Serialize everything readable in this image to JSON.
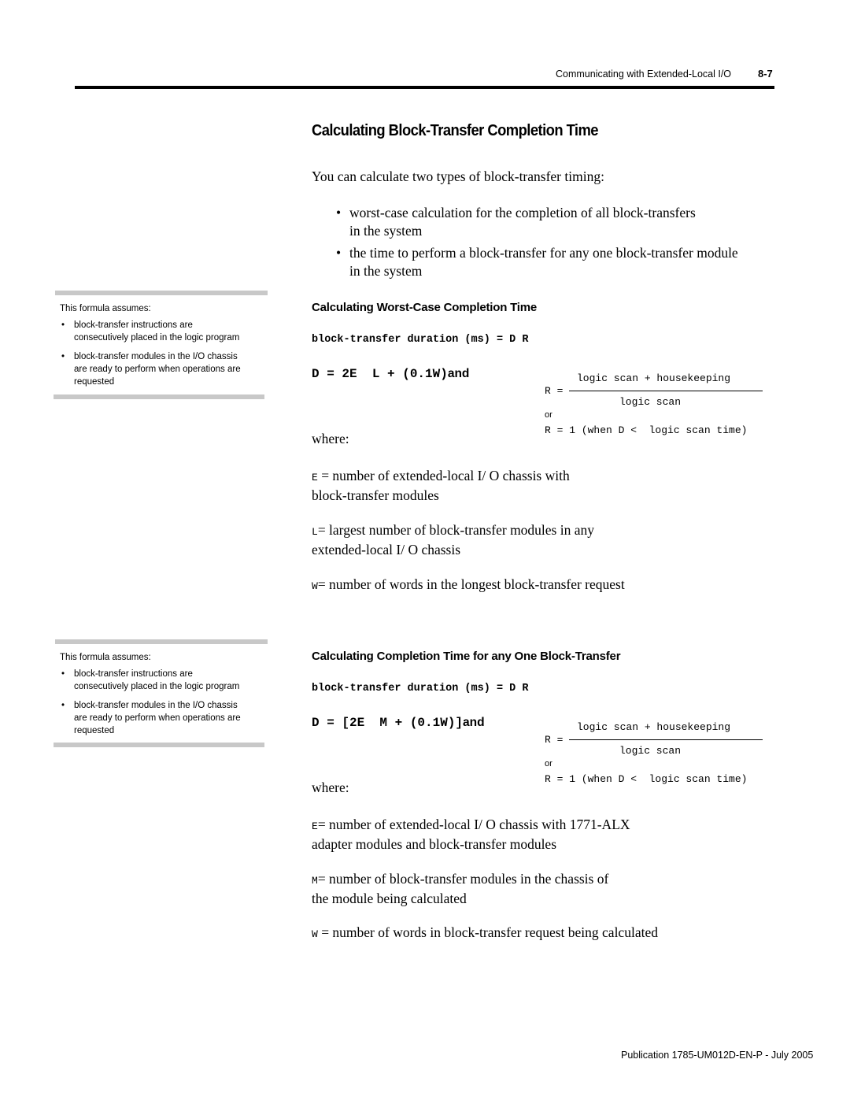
{
  "header": {
    "running_title": "Communicating with Extended-Local I/O",
    "page_number": "8-7"
  },
  "title": "Calculating Block-Transfer Completion Time",
  "intro": "You can calculate two types of block-transfer timing:",
  "bullets": [
    {
      "line1": "worst-case calculation for the completion of all block-transfers",
      "line2": "in the system"
    },
    {
      "line1": "the time to perform a block-transfer for any one block-transfer module",
      "line2": "in the system"
    }
  ],
  "bullet_glyph": "•",
  "sections": [
    {
      "subhead": "Calculating Worst-Case Completion Time",
      "duration": "block-transfer duration (ms) = D  R",
      "d_formula": "D = 2E  L + (0.1W)",
      "and": "and",
      "r_label": "R =",
      "r_numerator": "logic scan + housekeeping",
      "r_denominator": "logic scan",
      "or": "or",
      "r_alt": "R = 1 (when D <  logic scan time)",
      "where": "where:",
      "definitions": [
        {
          "var": "E",
          "line1": " = number of extended-local I/ O chassis with",
          "line2": "block-transfer modules"
        },
        {
          "var": "L",
          "line1": "= largest number of block-transfer modules in any",
          "line2": "extended-local I/ O chassis"
        },
        {
          "var": "W",
          "line1": "= number of words in the longest block-transfer request",
          "line2": ""
        }
      ],
      "sidebar": {
        "heading": "This formula assumes:",
        "items": [
          {
            "line1": "block-transfer instructions are",
            "line2": "consecutively placed in the logic program",
            "line3": ""
          },
          {
            "line1": "block-transfer modules in the I/O chassis",
            "line2": "are ready to perform when operations are",
            "line3": "requested"
          }
        ]
      }
    },
    {
      "subhead": "Calculating Completion Time for any One Block-Transfer",
      "duration": "block-transfer duration (ms) = D  R",
      "d_formula": "D = [2E  M + (0.1W)]",
      "and": "and",
      "r_label": "R =",
      "r_numerator": "logic scan + housekeeping",
      "r_denominator": "logic scan",
      "or": "or",
      "r_alt": "R = 1 (when D <  logic scan time)",
      "where": "where:",
      "definitions": [
        {
          "var": "E",
          "line1": "= number of extended-local I/ O chassis with 1771-ALX",
          "line2": "adapter modules and block-transfer modules"
        },
        {
          "var": "M",
          "line1": "= number of block-transfer modules in the chassis of",
          "line2": "the module being calculated"
        },
        {
          "var": "W",
          "line1": " = number of words in block-transfer request being calculated",
          "line2": ""
        }
      ],
      "sidebar": {
        "heading": "This formula assumes:",
        "items": [
          {
            "line1": "block-transfer instructions are",
            "line2": "consecutively placed in the logic program",
            "line3": ""
          },
          {
            "line1": "block-transfer modules in the I/O chassis",
            "line2": "are ready to perform when operations are",
            "line3": "requested"
          }
        ]
      }
    }
  ],
  "footer": "Publication 1785-UM012D-EN-P - July 2005"
}
